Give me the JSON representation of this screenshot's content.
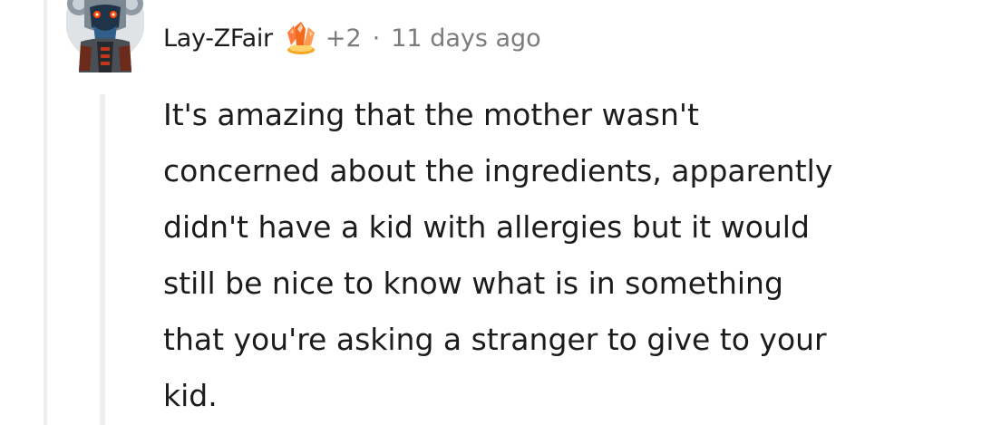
{
  "comment": {
    "username": "Lay-ZFair",
    "award": {
      "icon": "crystal-award-icon",
      "count": "+2"
    },
    "separator": "·",
    "timestamp": "11 days ago",
    "body_lines": [
      "It's amazing that the mother wasn't",
      "concerned about the ingredients, apparently",
      "didn't have a kid with allergies but it would",
      "still be nice to know what is in something",
      "that you're asking a stranger to give to your",
      "kid."
    ]
  },
  "colors": {
    "text_primary": "#1c1c1c",
    "text_meta": "#7c7c7c",
    "thread_line": "#edeff1",
    "award_orange": "#f26b1d"
  }
}
